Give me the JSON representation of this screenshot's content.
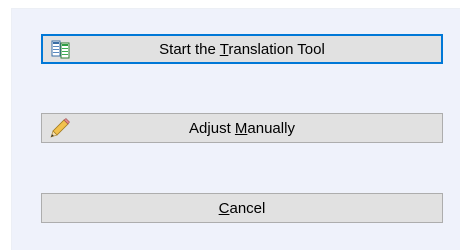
{
  "buttons": {
    "start": {
      "label_before": "Start the ",
      "label_accel": "T",
      "label_after": "ranslation Tool",
      "icon": "translation-tool-icon"
    },
    "adjust": {
      "label_before": "Adjust ",
      "label_accel": "M",
      "label_after": "anually",
      "icon": "pencil-icon"
    },
    "cancel": {
      "label_before": "",
      "label_accel": "C",
      "label_after": "ancel"
    }
  },
  "colors": {
    "panel_background": "#eff2fb",
    "button_face": "#e1e1e1",
    "button_border": "#adadad",
    "focus_border": "#0078d7"
  }
}
